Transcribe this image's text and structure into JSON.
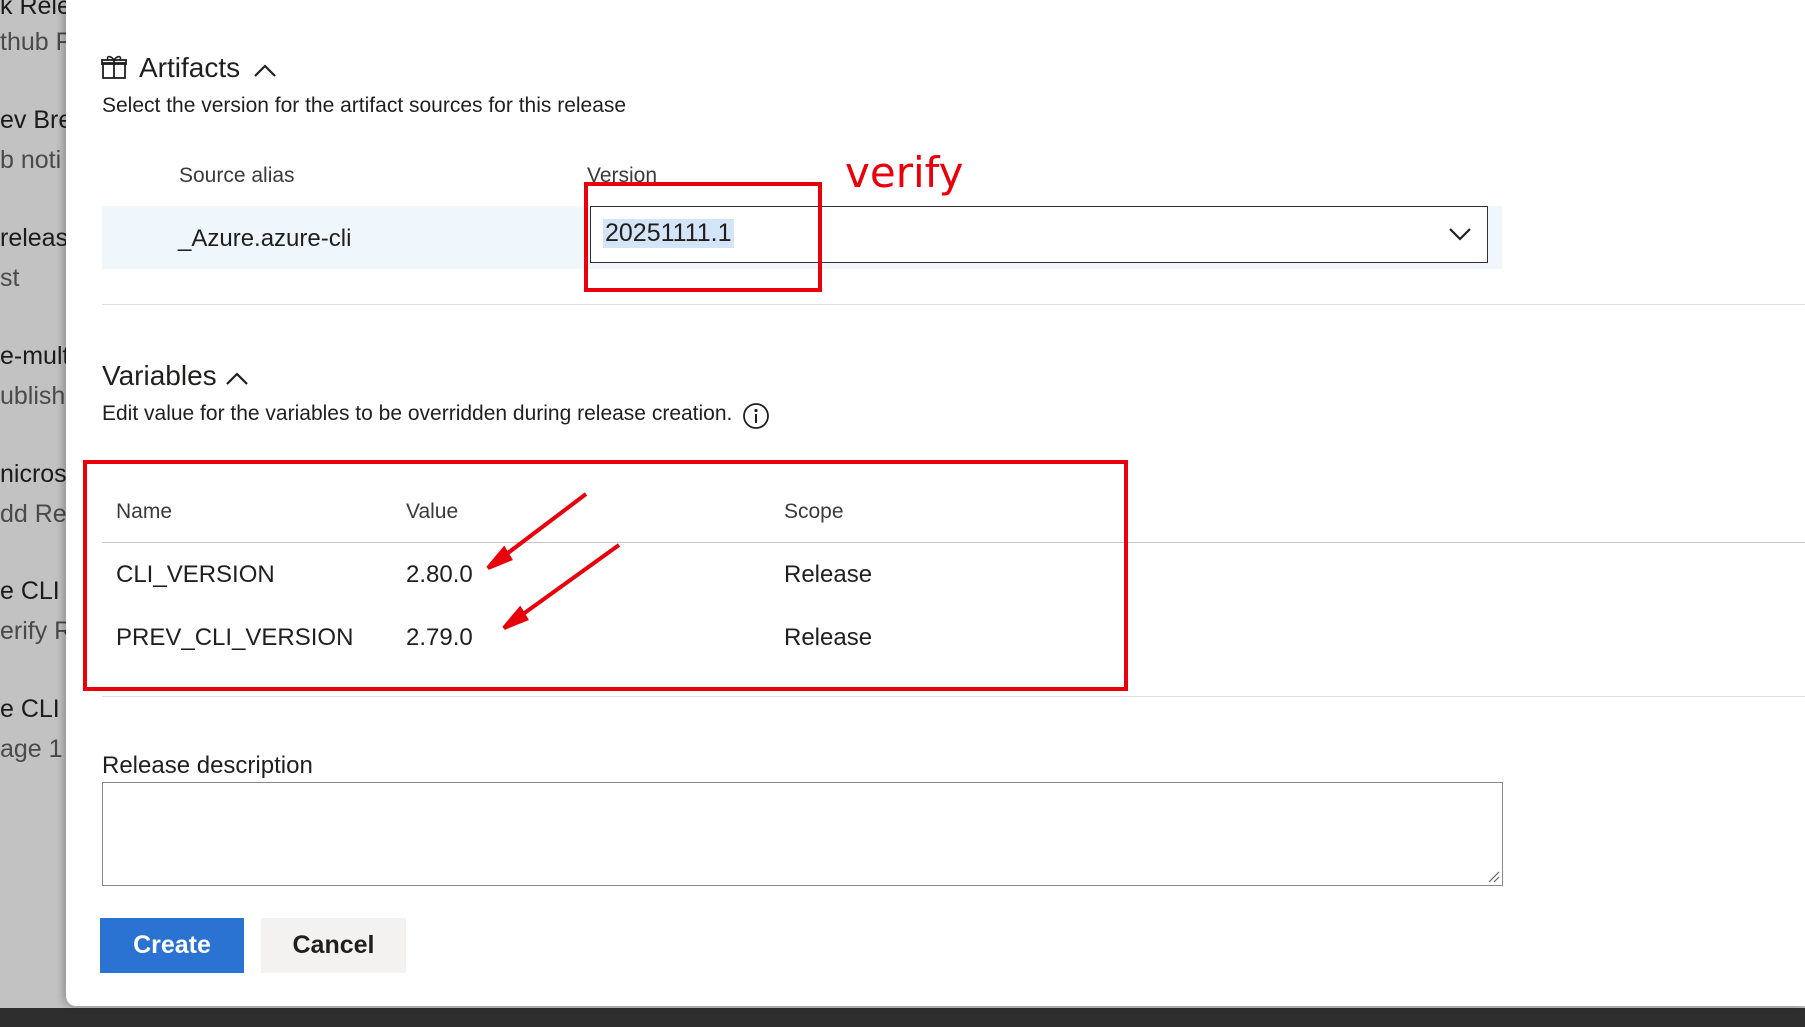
{
  "background_list": [
    {
      "title": "k Rele",
      "subtitle": "thub F"
    },
    {
      "title": "ev Brea",
      "subtitle": "b noti"
    },
    {
      "title": " releas",
      "subtitle": "st"
    },
    {
      "title": "e-mult",
      "subtitle": "ublish "
    },
    {
      "title": "nicros",
      "subtitle": "dd Rel"
    },
    {
      "title": "e CLI",
      "subtitle": "erify R"
    },
    {
      "title": "e CLI",
      "subtitle": "age 1"
    }
  ],
  "artifacts": {
    "title": "Artifacts",
    "icon": "gift-icon",
    "subtitle": "Select the version for the artifact sources for this release",
    "col_source": "Source alias",
    "col_version": "Version",
    "rows": [
      {
        "source": "_Azure.azure-cli",
        "version": "20251111.1"
      }
    ]
  },
  "variables": {
    "title": "Variables",
    "subtitle": "Edit value for the variables to be overridden during release creation.",
    "col_name": "Name",
    "col_value": "Value",
    "col_scope": "Scope",
    "rows": [
      {
        "name": "CLI_VERSION",
        "value": "2.80.0",
        "scope": "Release"
      },
      {
        "name": "PREV_CLI_VERSION",
        "value": "2.79.0",
        "scope": "Release"
      }
    ]
  },
  "release_description": {
    "label": "Release description",
    "value": ""
  },
  "buttons": {
    "create": "Create",
    "cancel": "Cancel"
  },
  "annotations": {
    "verify_label": "verify",
    "color": "#e8000b"
  },
  "colors": {
    "primary": "#2b73d2",
    "selected_row": "#eff6fc"
  }
}
